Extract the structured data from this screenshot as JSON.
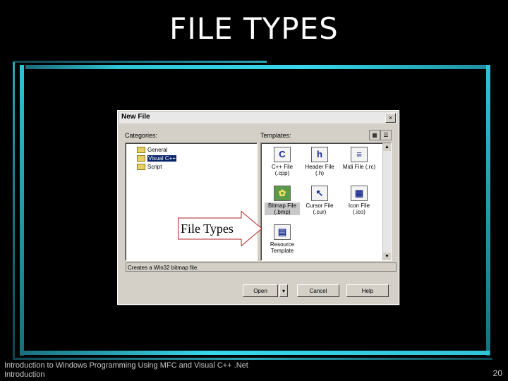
{
  "slide": {
    "title": "FILE TYPES",
    "footer_line1": "Introduction to Windows Programming Using MFC and Visual C++ .Net",
    "footer_line2": "Introduction",
    "page_number": "20"
  },
  "dialog": {
    "title": "New File",
    "close_label": "×",
    "categories_label": "Categories:",
    "templates_label": "Templates:",
    "categories": [
      "General",
      "Visual C++",
      "Script"
    ],
    "selected_category": "Visual C++",
    "templates": [
      {
        "label": "C++ File (.cpp)",
        "icon": "cpp-file-icon",
        "glyph": "C"
      },
      {
        "label": "Header File (.h)",
        "icon": "header-file-icon",
        "glyph": "h"
      },
      {
        "label": "Midi File (.rc)",
        "icon": "midi-file-icon",
        "glyph": "≡"
      },
      {
        "label": "Bitmap File (.bmp)",
        "icon": "bitmap-file-icon",
        "glyph": "✿"
      },
      {
        "label": "Cursor File (.cur)",
        "icon": "cursor-file-icon",
        "glyph": "↖"
      },
      {
        "label": "Icon File (.ico)",
        "icon": "icon-file-icon",
        "glyph": "▦"
      },
      {
        "label": "Resource Template",
        "icon": "resource-template-icon",
        "glyph": "▤"
      }
    ],
    "description": "Creates a Win32 bitmap file.",
    "open_label": "Open",
    "cancel_label": "Cancel",
    "help_label": "Help"
  },
  "callout": {
    "text": "File Types"
  },
  "colors": {
    "background": "#000000",
    "frame_accent": "#2fc4d6",
    "selection": "#0a246a"
  }
}
